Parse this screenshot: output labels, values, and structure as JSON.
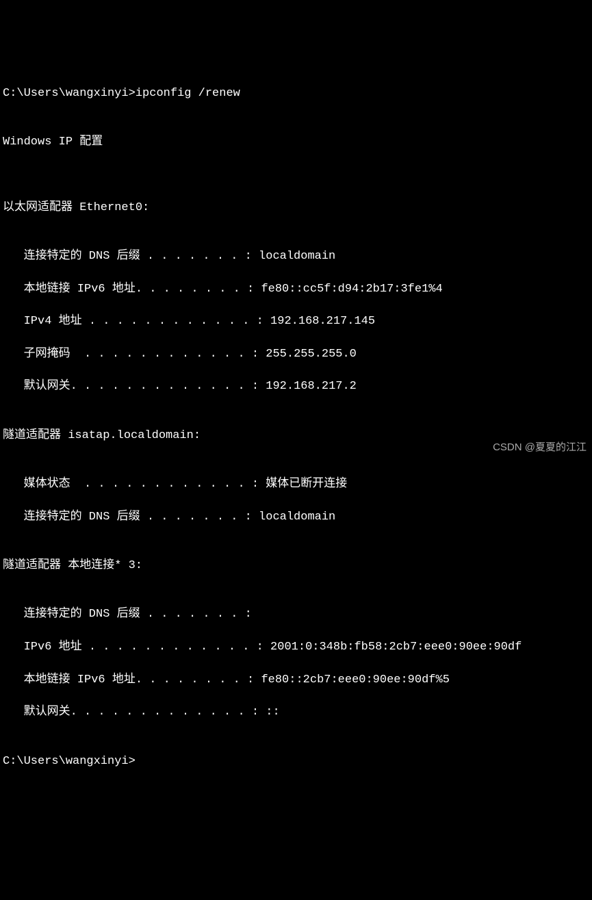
{
  "prompt1": {
    "path": "C:\\Users\\wangxinyi>",
    "command": "ipconfig /renew"
  },
  "blank": "",
  "header": "Windows IP 配置",
  "adapter1": {
    "title": "以太网适配器 Ethernet0:",
    "entries": {
      "dns_label": "   连接特定的 DNS 后缀 . . . . . . . :",
      "dns_value": " localdomain",
      "ipv6ll_label": "   本地链接 IPv6 地址. . . . . . . . :",
      "ipv6ll_value": " fe80::cc5f:d94:2b17:3fe1%4",
      "ipv4_label": "   IPv4 地址 . . . . . . . . . . . . :",
      "ipv4_value": " 192.168.217.145",
      "mask_label": "   子网掩码  . . . . . . . . . . . . :",
      "mask_value": " 255.255.255.0",
      "gw_label": "   默认网关. . . . . . . . . . . . . :",
      "gw_value": " 192.168.217.2"
    }
  },
  "adapter2": {
    "title": "隧道适配器 isatap.localdomain:",
    "entries": {
      "media_label": "   媒体状态  . . . . . . . . . . . . :",
      "media_value": " 媒体已断开连接",
      "dns_label": "   连接特定的 DNS 后缀 . . . . . . . :",
      "dns_value": " localdomain"
    }
  },
  "adapter3": {
    "title": "隧道适配器 本地连接* 3:",
    "entries": {
      "dns_label": "   连接特定的 DNS 后缀 . . . . . . . :",
      "dns_value": "",
      "ipv6_label": "   IPv6 地址 . . . . . . . . . . . . :",
      "ipv6_value": " 2001:0:348b:fb58:2cb7:eee0:90ee:90df",
      "ipv6ll_label": "   本地链接 IPv6 地址. . . . . . . . :",
      "ipv6ll_value": " fe80::2cb7:eee0:90ee:90df%5",
      "gw_label": "   默认网关. . . . . . . . . . . . . :",
      "gw_value": " ::"
    }
  },
  "prompt2": {
    "path": "C:\\Users\\wangxinyi>"
  },
  "watermark": "CSDN @夏夏的江江"
}
